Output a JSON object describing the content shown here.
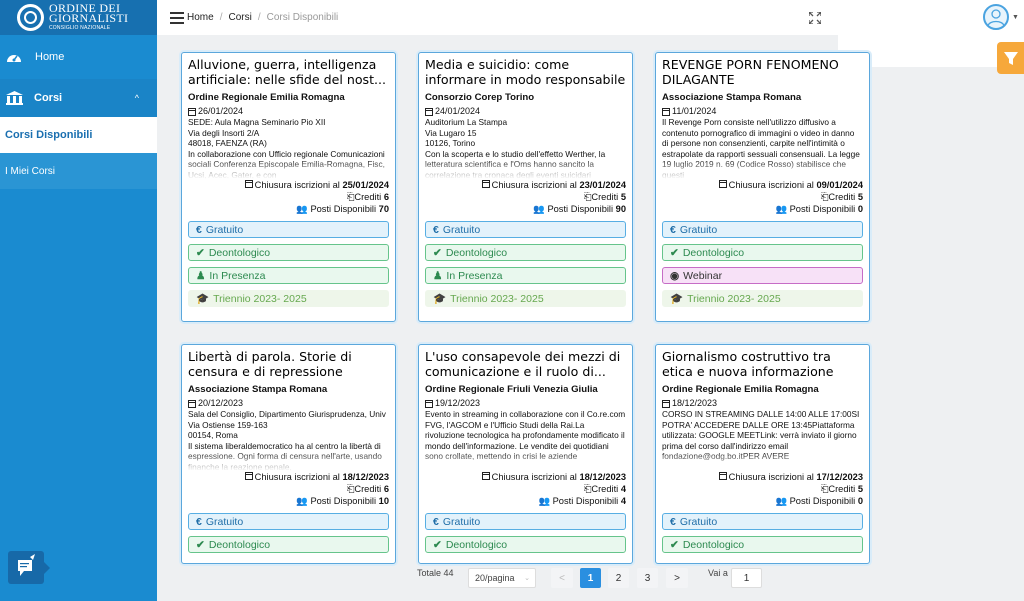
{
  "sidebar": {
    "logo_line1": "ORDINE DEI",
    "logo_line2": "GIORNALISTI",
    "logo_line3": "CONSIGLIO NAZIONALE",
    "home": "Home",
    "corsi": "Corsi",
    "sub_active": "Corsi Disponibili",
    "sub_other": "I Miei Corsi"
  },
  "header": {
    "crumb_home": "Home",
    "crumb_corsi": "Corsi",
    "crumb_current": "Corsi Disponibili",
    "sep": "/"
  },
  "labels": {
    "chiusura": "Chiusura iscrizioni al ",
    "crediti": "Crediti ",
    "posti": "Posti Disponibili "
  },
  "cards": [
    {
      "title": "Alluvione, guerra, intelligenza artificiale: nelle sfide del nost...",
      "org": "Ordine Regionale Emilia Romagna",
      "date": "26/01/2024",
      "desc": "SEDE: Aula Magna Seminario Pio XII\nVia degli Insorti 2/A\n48018, FAENZA (RA)\nIn collaborazione con Ufficio regionale Comunicazioni sociali Conferenza Episcopale Emilia-Romagna, Fisc, Ucsi, Acec, Gater, e con",
      "chiusura": "25/01/2024",
      "crediti": "6",
      "posti": "70",
      "pills": [
        {
          "icon": "€",
          "label": "Gratuito",
          "style": "p-blue"
        },
        {
          "icon": "✔",
          "label": "Deontologico",
          "style": "p-green"
        },
        {
          "icon": "♟",
          "label": "In Presenza",
          "style": "p-green"
        },
        {
          "icon": "🎓",
          "label": "Triennio 2023- 2025",
          "style": "p-lgreen"
        }
      ]
    },
    {
      "title": "Media e suicidio: come informare in modo responsabile",
      "org": "Consorzio Corep Torino",
      "date": "24/01/2024",
      "desc": "Auditorium La Stampa\nVia Lugaro 15\n10126, Torino\nCon la scoperta e lo studio dell'effetto Werther, la letteratura scientifica e l'Oms hanno sancito la correlazione tra cronaca degli eventi suicidari",
      "chiusura": "23/01/2024",
      "crediti": "5",
      "posti": "90",
      "pills": [
        {
          "icon": "€",
          "label": "Gratuito",
          "style": "p-blue"
        },
        {
          "icon": "✔",
          "label": "Deontologico",
          "style": "p-green"
        },
        {
          "icon": "♟",
          "label": "In Presenza",
          "style": "p-green"
        },
        {
          "icon": "🎓",
          "label": "Triennio 2023- 2025",
          "style": "p-lgreen"
        }
      ]
    },
    {
      "title": "REVENGE PORN FENOMENO DILAGANTE",
      "org": "Associazione Stampa Romana",
      "date": "11/01/2024",
      "desc": "Il Revenge Porn consiste nell'utilizzo diffusivo a contenuto pornografico di immagini o video in danno di persone non consenzienti, carpite nell'intimità o estrapolate da rapporti sessuali consensuali. La legge 19 luglio 2019 n. 69 (Codice Rosso) stabilisce che questi",
      "chiusura": "09/01/2024",
      "crediti": "5",
      "posti": "0",
      "pills": [
        {
          "icon": "€",
          "label": "Gratuito",
          "style": "p-blue"
        },
        {
          "icon": "✔",
          "label": "Deontologico",
          "style": "p-green"
        },
        {
          "icon": "◉",
          "label": "Webinar",
          "style": "p-purple"
        },
        {
          "icon": "🎓",
          "label": "Triennio 2023- 2025",
          "style": "p-lgreen"
        }
      ]
    },
    {
      "title": "Libertà di parola. Storie di censura e di repressione pena...",
      "org": "Associazione Stampa Romana",
      "date": "20/12/2023",
      "desc": "Sala del Consiglio, Dipartimento Giurisprudenza, Univ\nVia Ostiense 159-163\n00154, Roma\nIl sistema liberaldemocratico ha al centro la libertà di espressione. Ogni forma di censura nell'arte, usando finanche la reazione penale,",
      "chiusura": "18/12/2023",
      "crediti": "6",
      "posti": "10",
      "pills": [
        {
          "icon": "€",
          "label": "Gratuito",
          "style": "p-blue"
        },
        {
          "icon": "✔",
          "label": "Deontologico",
          "style": "p-green"
        }
      ]
    },
    {
      "title": "L'uso consapevole dei mezzi di comunicazione e il ruolo di...",
      "org": "Ordine Regionale Friuli Venezia Giulia",
      "date": "19/12/2023",
      "desc": "Evento in streaming in collaborazione con il Co.re.com FVG, l'AGCOM e l'Ufficio Studi della Rai.La rivoluzione tecnologica ha profondamente modificato il mondo dell'informazione. Le vendite dei quotidiani sono crollate, mettendo in crisi le aziende",
      "chiusura": "18/12/2023",
      "crediti": "4",
      "posti": "4",
      "pills": [
        {
          "icon": "€",
          "label": "Gratuito",
          "style": "p-blue"
        },
        {
          "icon": "✔",
          "label": "Deontologico",
          "style": "p-green"
        }
      ]
    },
    {
      "title": "Giornalismo costruttivo tra etica e nuova informazione",
      "org": "Ordine Regionale Emilia Romagna",
      "date": "18/12/2023",
      "desc": "CORSO IN STREAMING DALLE 14:00 ALLE 17:00SI POTRA' ACCEDERE DALLE ORE 13:45Piattaforma utilizzata: GOOGLE MEETLink: verrà inviato il giorno prima del corso dall'indirizzo email fondazione@odg.bo.itPER AVERE",
      "chiusura": "17/12/2023",
      "crediti": "5",
      "posti": "0",
      "pills": [
        {
          "icon": "€",
          "label": "Gratuito",
          "style": "p-blue"
        },
        {
          "icon": "✔",
          "label": "Deontologico",
          "style": "p-green"
        }
      ]
    }
  ],
  "pagination": {
    "total": "Totale 44",
    "per_page": "20/pagina",
    "prev": "<",
    "next": ">",
    "pages": [
      "1",
      "2",
      "3"
    ],
    "current": "1",
    "goto_label": "Vai a",
    "goto_value": "1"
  },
  "colors": {
    "sidebar": "#1a8bd0",
    "accent": "#1a8bd0",
    "filter": "#f6a83b"
  }
}
